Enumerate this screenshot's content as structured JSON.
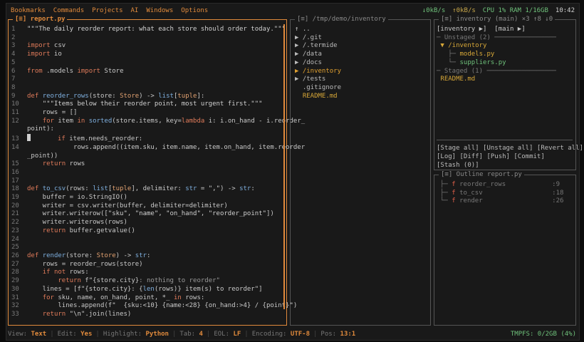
{
  "menu": [
    "Bookmarks",
    "Commands",
    "Projects",
    "AI",
    "Windows",
    "Options"
  ],
  "sysinfo": {
    "down": "↓0kB/s",
    "up": "↑0kB/s",
    "cpu": "CPU 1% RAM 1/16GB",
    "clock": "10:42"
  },
  "editor": {
    "title": "[≡] report.py"
  },
  "filetree": {
    "title": "[≡] /tmp/demo/inventory"
  },
  "git": {
    "title": "[≡] inventory (main) ×3 ↑8 ↓0"
  },
  "outline": {
    "title": "[≡] Outline report.py"
  },
  "status": {
    "view_k": "View:",
    "view_v": "Text",
    "edit_k": "Edit:",
    "edit_v": "Yes",
    "hl_k": "Highlight:",
    "hl_v": "Python",
    "tab_k": "Tab:",
    "tab_v": "4",
    "eol_k": "EOL:",
    "eol_v": "LF",
    "enc_k": "Encoding:",
    "enc_v": "UTF-8",
    "pos_k": "Pos:",
    "pos_v": "13:1",
    "tmpfs": "TMPFS: 0/2GB (4%)"
  }
}
